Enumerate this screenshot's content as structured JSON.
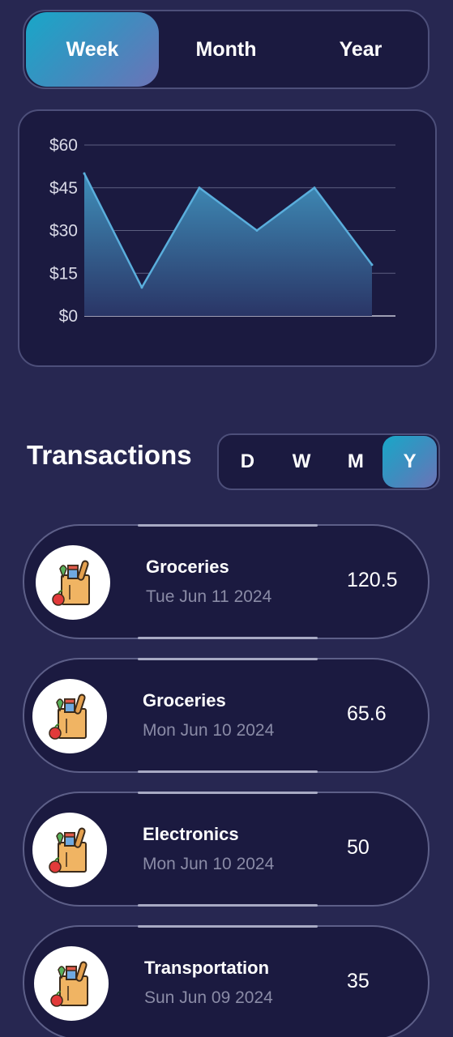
{
  "period_tabs": [
    {
      "label": "Week",
      "active": true
    },
    {
      "label": "Month",
      "active": false
    },
    {
      "label": "Year",
      "active": false
    }
  ],
  "chart_data": {
    "type": "area",
    "title": "",
    "xlabel": "",
    "ylabel": "",
    "x": [
      1,
      2,
      3,
      4,
      5,
      6
    ],
    "values": [
      50,
      10,
      45,
      30,
      45,
      18
    ],
    "ylim": [
      0,
      60
    ],
    "yticks": [
      0,
      15,
      30,
      45,
      60
    ],
    "ytick_labels": [
      "$0",
      "$15",
      "$30",
      "$45",
      "$60"
    ],
    "grid": true,
    "line_color": "#5aaedc",
    "fill_top_color": "#3f8fba",
    "fill_bottom_color": "#2a3566"
  },
  "transactions": {
    "title": "Transactions",
    "range_tabs": [
      {
        "label": "D",
        "active": false
      },
      {
        "label": "W",
        "active": false
      },
      {
        "label": "M",
        "active": false
      },
      {
        "label": "Y",
        "active": true
      }
    ],
    "items": [
      {
        "category": "Groceries",
        "date": "Tue Jun 11 2024",
        "amount": "120.5",
        "icon": "grocery-bag-icon"
      },
      {
        "category": "Groceries",
        "date": "Mon Jun 10 2024",
        "amount": "65.6",
        "icon": "grocery-bag-icon"
      },
      {
        "category": "Electronics",
        "date": "Mon Jun 10 2024",
        "amount": "50",
        "icon": "grocery-bag-icon"
      },
      {
        "category": "Transportation",
        "date": "Sun Jun 09 2024",
        "amount": "35",
        "icon": "grocery-bag-icon"
      }
    ]
  },
  "colors": {
    "background": "#272751",
    "card": "#1b1a40",
    "accent_gradient_start": "#18a7c8",
    "accent_gradient_end": "#6c73b7"
  }
}
